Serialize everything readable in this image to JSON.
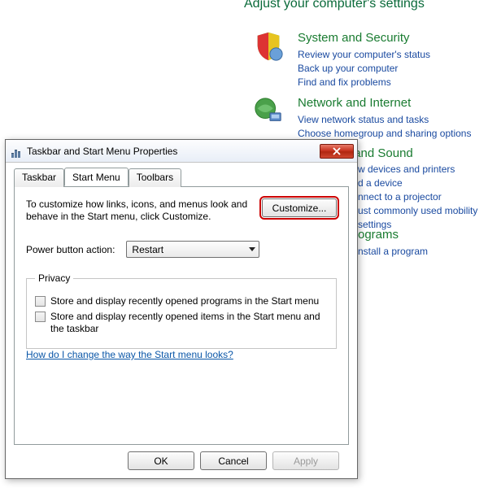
{
  "control_panel": {
    "heading": "Adjust your computer's settings",
    "sections": [
      {
        "title": "System and Security",
        "links": [
          "Review your computer's status",
          "Back up your computer",
          "Find and fix problems"
        ]
      },
      {
        "title": "Network and Internet",
        "links": [
          "View network status and tasks",
          "Choose homegroup and sharing options"
        ]
      },
      {
        "title": "Hardware and Sound",
        "links": [
          "View devices and printers",
          "Add a device",
          "Connect to a projector",
          "Adjust commonly used mobility settings"
        ]
      },
      {
        "title": "Programs",
        "links": [
          "Uninstall a program"
        ]
      }
    ]
  },
  "dialog": {
    "title": "Taskbar and Start Menu Properties",
    "tabs": [
      "Taskbar",
      "Start Menu",
      "Toolbars"
    ],
    "active_tab": 1,
    "customize_text": "To customize how links, icons, and menus look and behave in the Start menu, click Customize.",
    "customize_btn": "Customize...",
    "power_label": "Power button action:",
    "power_value": "Restart",
    "privacy_legend": "Privacy",
    "priv1": "Store and display recently opened programs in the Start menu",
    "priv2": "Store and display recently opened items in the Start menu and the taskbar",
    "help_link": "How do I change the way the Start menu looks?",
    "ok": "OK",
    "cancel": "Cancel",
    "apply": "Apply"
  }
}
